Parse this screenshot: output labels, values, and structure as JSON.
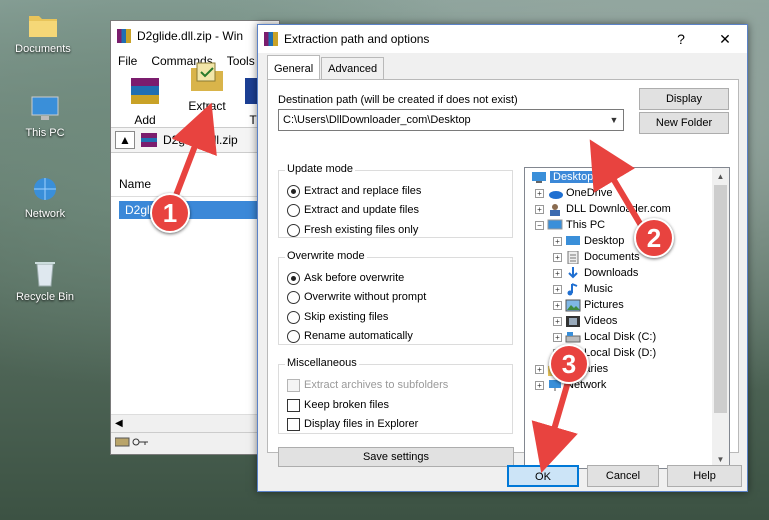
{
  "desktop": {
    "icons": [
      {
        "label": "Documents",
        "icon": "folder-icon"
      },
      {
        "label": "This PC",
        "icon": "computer-icon"
      },
      {
        "label": "Network",
        "icon": "network-icon"
      },
      {
        "label": "Recycle Bin",
        "icon": "recycle-bin-icon"
      }
    ]
  },
  "winrar": {
    "title": "D2glide.dll.zip - Win",
    "menu": [
      "File",
      "Commands",
      "Tools"
    ],
    "toolbar": {
      "add_label": "Add",
      "extract_label": "Extract To",
      "third_label": "T"
    },
    "path_value": "D2glide.dll.zip",
    "column_name": "Name",
    "file_name": "D2glide.dll"
  },
  "dialog": {
    "title": "Extraction path and options",
    "help_glyph": "?",
    "close_glyph": "✕",
    "tabs": [
      "General",
      "Advanced"
    ],
    "destination_label": "Destination path (will be created if does not exist)",
    "destination_value": "C:\\Users\\DllDownloader_com\\Desktop",
    "display_button": "Display",
    "new_folder_button": "New Folder",
    "update_mode": {
      "title": "Update mode",
      "options": [
        "Extract and replace files",
        "Extract and update files",
        "Fresh existing files only"
      ],
      "selected": 0
    },
    "overwrite_mode": {
      "title": "Overwrite mode",
      "options": [
        "Ask before overwrite",
        "Overwrite without prompt",
        "Skip existing files",
        "Rename automatically"
      ],
      "selected": 0
    },
    "misc": {
      "title": "Miscellaneous",
      "options": [
        "Extract archives to subfolders",
        "Keep broken files",
        "Display files in Explorer"
      ]
    },
    "save_settings_button": "Save settings",
    "tree": [
      {
        "label": "Desktop",
        "icon": "desktop-icon"
      },
      {
        "label": "OneDrive",
        "icon": "onedrive-icon"
      },
      {
        "label": "DLL Downloader.com",
        "icon": "user-icon"
      },
      {
        "label": "This PC",
        "icon": "computer-icon"
      },
      {
        "label": "Desktop",
        "icon": "desktop-icon"
      },
      {
        "label": "Documents",
        "icon": "documents-icon"
      },
      {
        "label": "Downloads",
        "icon": "downloads-icon"
      },
      {
        "label": "Music",
        "icon": "music-icon"
      },
      {
        "label": "Pictures",
        "icon": "pictures-icon"
      },
      {
        "label": "Videos",
        "icon": "videos-icon"
      },
      {
        "label": "Local Disk (C:)",
        "icon": "drive-icon"
      },
      {
        "label": "Local Disk (D:)",
        "icon": "drive-icon"
      },
      {
        "label": "Libraries",
        "icon": "libraries-icon"
      },
      {
        "label": "Network",
        "icon": "network-icon"
      }
    ],
    "ok_button": "OK",
    "cancel_button": "Cancel",
    "help_button": "Help"
  },
  "annotations": {
    "step1": "1",
    "step2": "2",
    "step3": "3"
  },
  "colors": {
    "accent": "#3b88d8",
    "annotation": "#e8433f"
  }
}
